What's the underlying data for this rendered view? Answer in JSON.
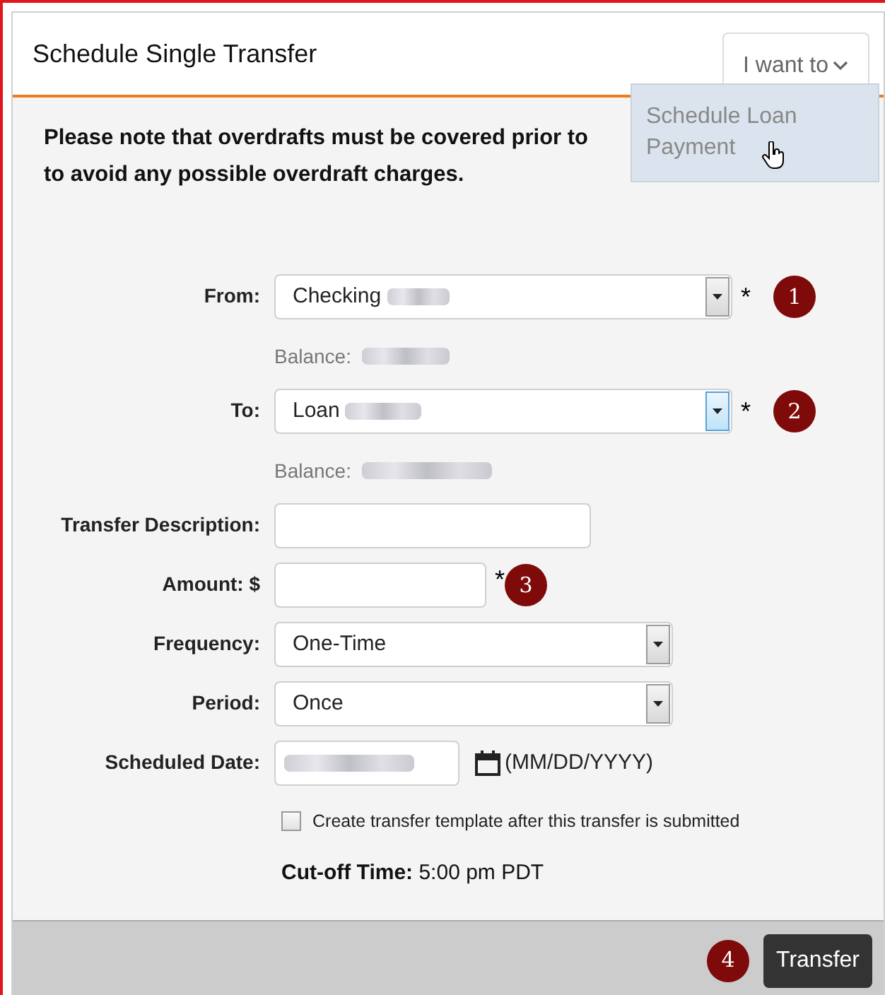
{
  "panel": {
    "title": "Schedule Single Transfer"
  },
  "menu": {
    "label": "I want to",
    "expanded": true,
    "items": [
      {
        "label": "Schedule Loan Payment",
        "hovered": true
      }
    ]
  },
  "notice_lines": [
    "Please note that overdrafts must be covered prior to",
    "to avoid any possible overdraft charges."
  ],
  "fields": [
    {
      "kind": "select",
      "label": "From:",
      "value": "Checking",
      "redacted": true,
      "required_mark": "*",
      "focused": false,
      "step": "1",
      "balance_label": "Balance:"
    },
    {
      "kind": "select",
      "label": "To:",
      "value": "Loan",
      "redacted": true,
      "required_mark": "*",
      "focused": true,
      "step": "2",
      "balance_label": "Balance:"
    },
    {
      "kind": "text",
      "label": "Transfer Description:"
    },
    {
      "kind": "amount",
      "label": "Amount: $",
      "required_mark": "*",
      "step": "3"
    },
    {
      "kind": "short-select",
      "label": "Frequency:",
      "value": "One-Time",
      "focused": false
    },
    {
      "kind": "short-select",
      "label": "Period:",
      "value": "Once",
      "focused": false
    },
    {
      "kind": "date",
      "label": "Scheduled Date:",
      "redacted": true,
      "hint": "(MM/DD/YYYY)"
    }
  ],
  "template_checkbox": {
    "label": "Create transfer template after this transfer is submitted",
    "checked": false
  },
  "cutoff": {
    "label": "Cut-off Time:",
    "value": "5:00 pm PDT"
  },
  "footer": {
    "step": "4",
    "button": "Transfer"
  }
}
